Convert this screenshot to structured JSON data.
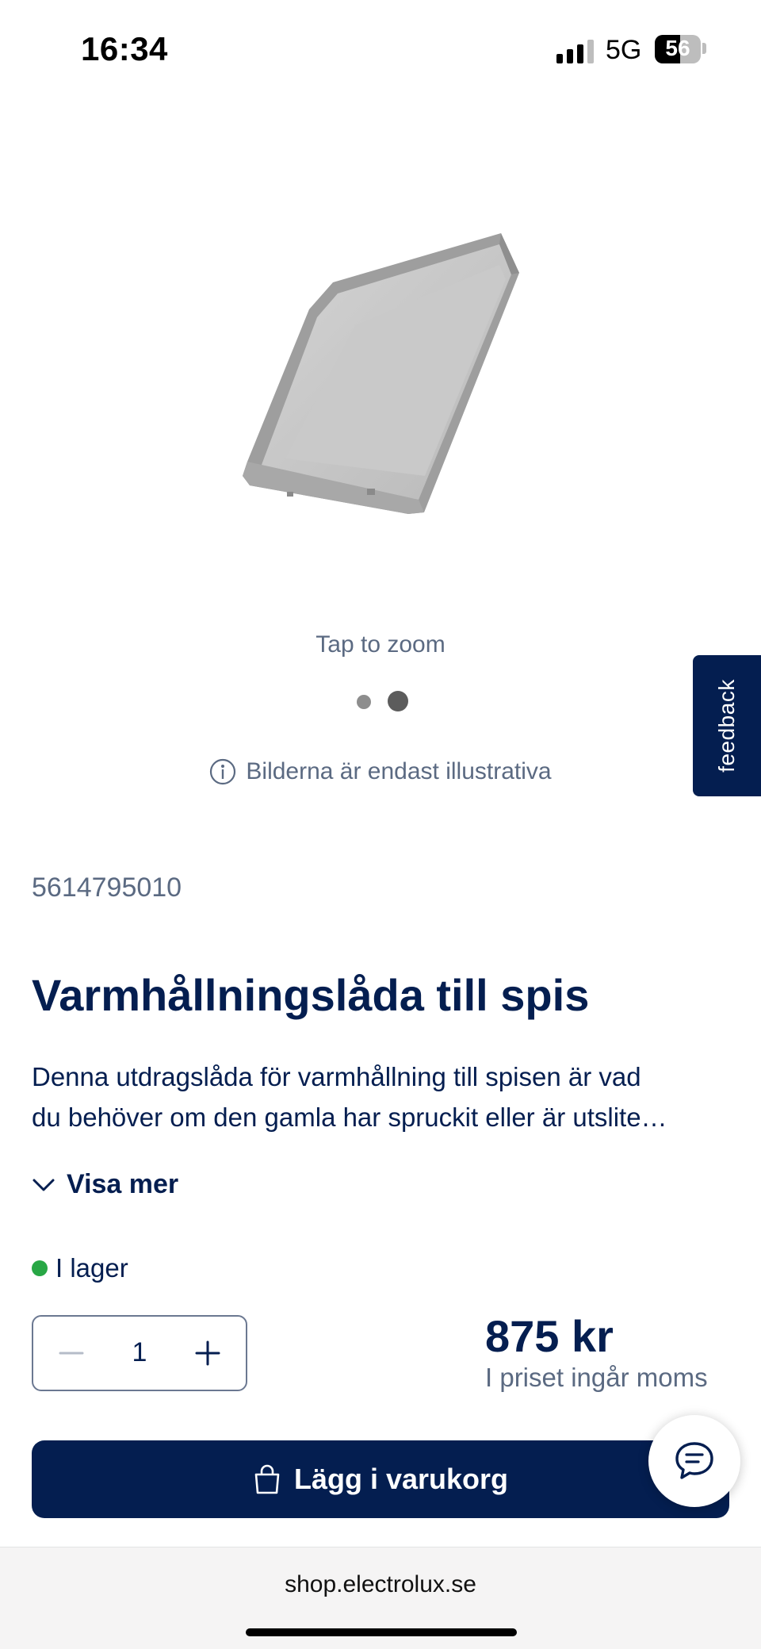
{
  "status_bar": {
    "time": "16:34",
    "network": "5G",
    "battery": "56",
    "battery_level": 0.56
  },
  "gallery": {
    "image_icon": "drawer-tray-image",
    "tap_to_zoom": "Tap to zoom",
    "dots_total": 2,
    "active_dot": 2,
    "disclaimer": "Bilderna är endast illustrativa"
  },
  "feedback": {
    "label": "feedback"
  },
  "product": {
    "sku": "5614795010",
    "title": "Varmhållningslåda till spis",
    "description_line1": "Denna utdragslåda för varmhållning till spisen är vad",
    "description_line2": "du behöver om den gamla har spruckit eller är utslite…",
    "show_more": "Visa mer",
    "stock_status": "I lager",
    "quantity": "1",
    "price": "875 kr",
    "price_note": "I priset ingår moms",
    "add_to_cart": "Lägg i varukorg"
  },
  "browser": {
    "url": "shop.electrolux.se"
  },
  "colors": {
    "brand_navy": "#041e50",
    "in_stock": "#28a745",
    "muted_text": "#5b6a82"
  }
}
